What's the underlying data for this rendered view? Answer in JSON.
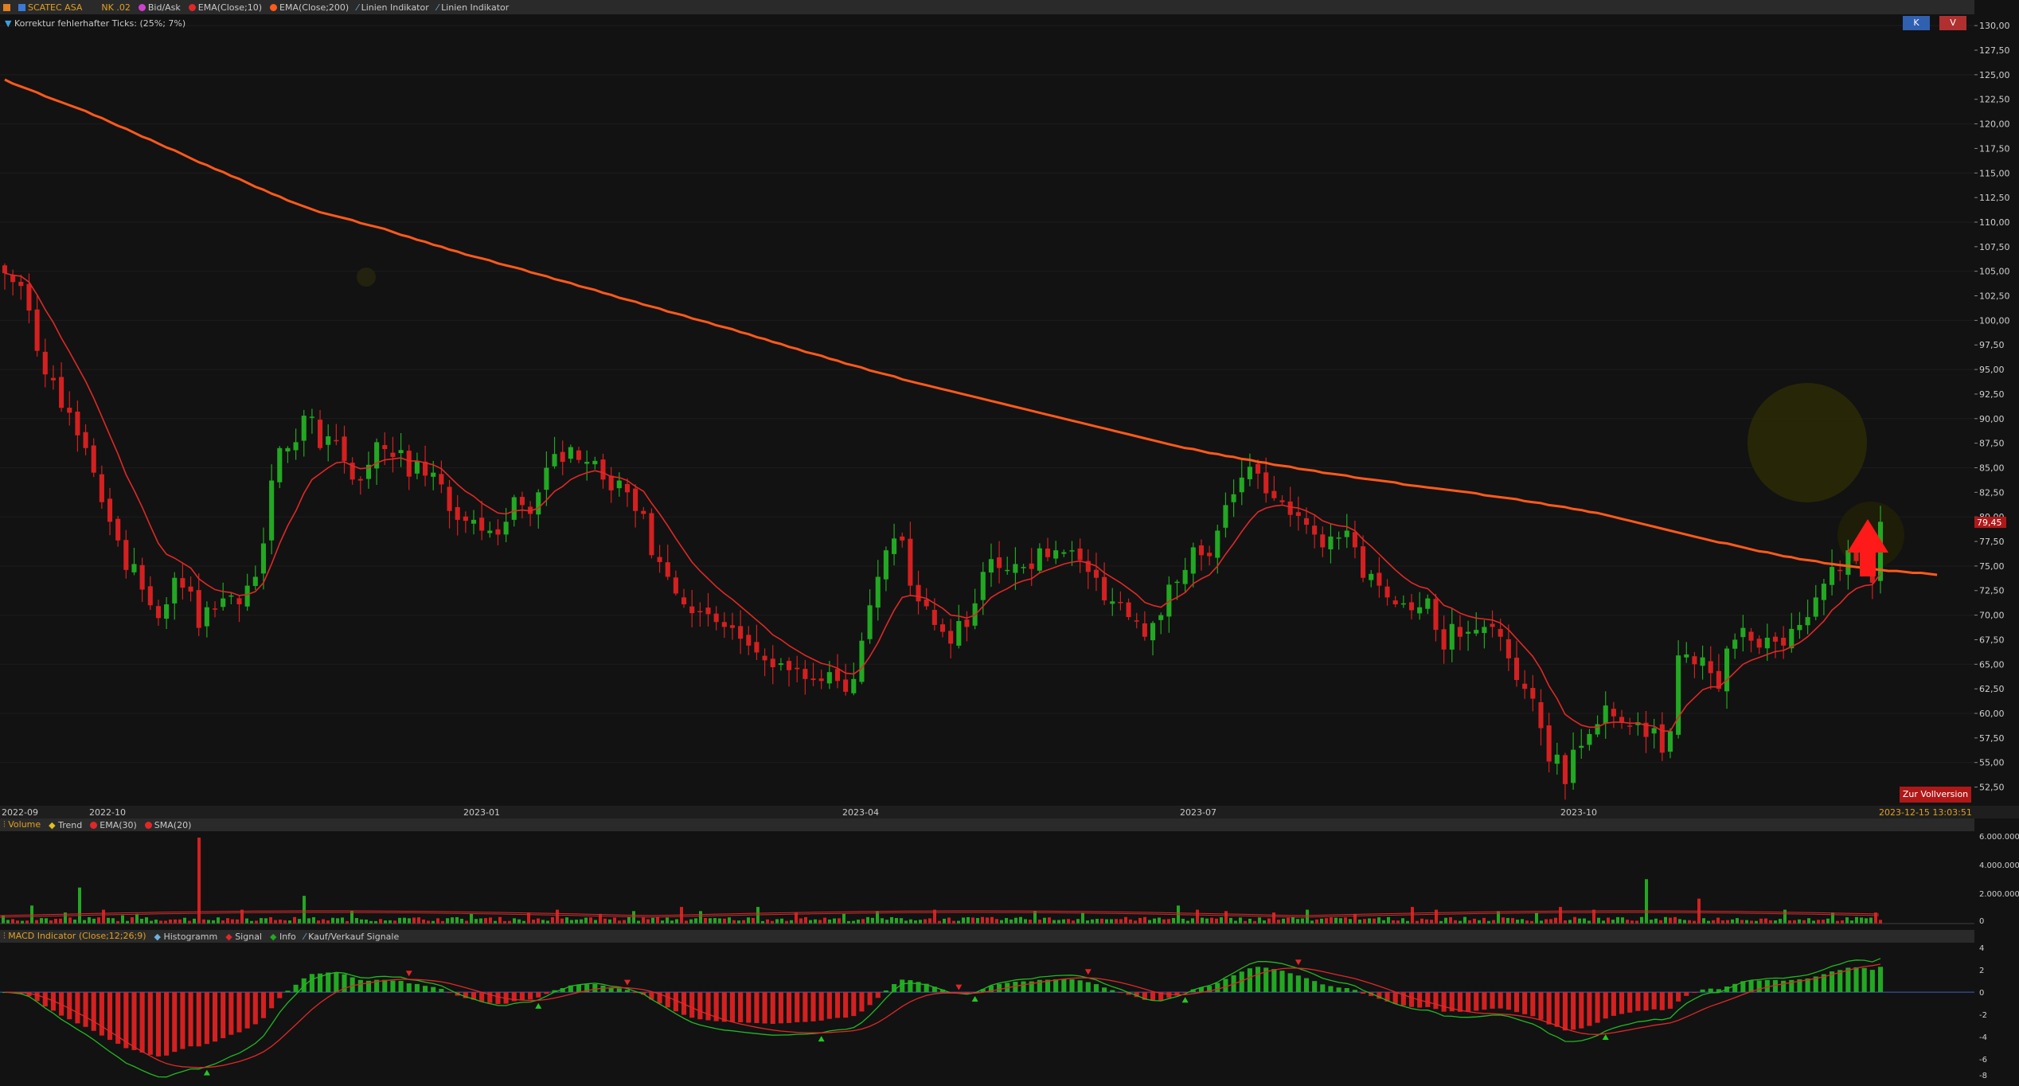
{
  "header": {
    "symbol": "SCATEC ASA",
    "nk": "NK .02",
    "indicators": [
      "Bid/Ask",
      "EMA(Close;10)",
      "EMA(Close;200)",
      "Linien Indikator",
      "Linien Indikator"
    ],
    "tick_correction": "Korrektur fehlerhafter Ticks: (25%; 7%)"
  },
  "buttons": {
    "k": "K",
    "v": "V",
    "full_version": "Zur Vollversion"
  },
  "price_axis": {
    "ticks": [
      "130,00",
      "127,50",
      "125,00",
      "122,50",
      "120,00",
      "117,50",
      "115,00",
      "112,50",
      "110,00",
      "107,50",
      "105,00",
      "102,50",
      "100,00",
      "97,50",
      "95,00",
      "92,50",
      "90,00",
      "87,50",
      "85,00",
      "82,50",
      "80,00",
      "77,50",
      "75,00",
      "72,50",
      "70,00",
      "67,50",
      "65,00",
      "62,50",
      "60,00",
      "57,50",
      "55,00",
      "52,50"
    ],
    "current_price": "79,45"
  },
  "time_axis": {
    "labels": [
      "2022-09",
      "2022-10",
      "2023-01",
      "2023-04",
      "2023-07",
      "2023-10"
    ],
    "timestamp": "2023-12-15 13:03:51"
  },
  "volume_panel": {
    "legend": [
      "Volume",
      "Trend",
      "EMA(30)",
      "SMA(20)"
    ],
    "axis": [
      "6.000.000",
      "4.000.000",
      "2.000.000",
      "0"
    ]
  },
  "macd_panel": {
    "legend": [
      "MACD Indicator (Close;12;26;9)",
      "Histogramm",
      "Signal",
      "Info",
      "Kauf/Verkauf Signale"
    ],
    "axis": [
      "4",
      "2",
      "0",
      "-2",
      "-4",
      "-6",
      "-8"
    ]
  },
  "colors": {
    "up": "#22a822",
    "down": "#d42020",
    "ema200": "#ff5a1a",
    "ema10": "#e02828",
    "arrow": "#ff1a1a",
    "badge": "#b01818"
  },
  "chart_data": {
    "type": "candlestick",
    "ylim": [
      50.6,
      130.5
    ],
    "closes": [
      104.8,
      103.9,
      103.5,
      101.0,
      96.9,
      94.5,
      93.9,
      91.1,
      90.6,
      88.3,
      87.0,
      84.5,
      81.5,
      79.5,
      77.6,
      74.6,
      75.2,
      72.6,
      71.0,
      69.7,
      71.1,
      73.8,
      72.8,
      72.4,
      68.7,
      70.8,
      70.6,
      71.7,
      72.0,
      71.1,
      73.0,
      73.9,
      77.3,
      83.7,
      87.0,
      87.0,
      87.6,
      90.3,
      90.2,
      87.0,
      88.2,
      87.8,
      85.7,
      83.8,
      83.7,
      85.3,
      87.6,
      86.9,
      86.1,
      86.8,
      84.1,
      85.7,
      84.2,
      84.5,
      83.3,
      80.6,
      79.7,
      79.6,
      79.7,
      78.6,
      78.6,
      78.2,
      79.5,
      82.0,
      81.2,
      80.3,
      82.5,
      85.0,
      86.4,
      85.6,
      87.1,
      85.8,
      85.6,
      85.7,
      83.8,
      82.7,
      83.7,
      82.5,
      80.6,
      80.3,
      76.1,
      75.4,
      73.9,
      72.2,
      71.1,
      70.2,
      70.4,
      70.1,
      69.3,
      68.8,
      68.7,
      67.6,
      66.9,
      66.2,
      65.4,
      64.7,
      65.1,
      64.4,
      64.5,
      63.5,
      63.4,
      63.3,
      64.2,
      63.3,
      62.2,
      63.5,
      67.4,
      71.0,
      73.9,
      76.6,
      77.8,
      77.6,
      73.0,
      71.4,
      70.9,
      69.0,
      68.3,
      67.1,
      69.4,
      68.8,
      71.2,
      74.4,
      75.7,
      74.8,
      74.6,
      75.2,
      74.9,
      74.7,
      76.8,
      75.9,
      76.6,
      76.4,
      76.6,
      75.6,
      74.4,
      73.8,
      71.5,
      71.4,
      71.3,
      69.8,
      69.4,
      67.8,
      69.2,
      70.0,
      73.1,
      73.4,
      74.6,
      76.9,
      76.1,
      76.0,
      78.6,
      81.2,
      82.3,
      84.0,
      85.1,
      84.4,
      82.4,
      81.9,
      81.5,
      80.2,
      80.1,
      79.2,
      78.2,
      76.9,
      78.0,
      77.9,
      78.6,
      76.9,
      73.8,
      74.2,
      73.0,
      71.8,
      71.1,
      71.2,
      70.5,
      70.8,
      71.7,
      68.5,
      66.5,
      69.1,
      67.8,
      68.3,
      68.5,
      68.8,
      68.8,
      67.8,
      65.6,
      63.4,
      62.5,
      61.5,
      58.5,
      55.1,
      55.8,
      52.8,
      56.3,
      56.7,
      57.9,
      58.9,
      60.8,
      59.7,
      59.1,
      58.7,
      59.1,
      57.6,
      58.5,
      56.0,
      58.2,
      65.9,
      66.0,
      65.0,
      65.7,
      64.1,
      62.5,
      66.6,
      67.5,
      68.7,
      67.4,
      66.7,
      67.7,
      67.3,
      66.9,
      68.6,
      69.0,
      69.8,
      71.8,
      73.2,
      74.9,
      74.5,
      76.6,
      75.5,
      74.7,
      73.3,
      79.5
    ],
    "ema200": [
      124.5,
      124.1,
      123.8,
      123.5,
      123.2,
      122.8,
      122.5,
      122.2,
      121.9,
      121.6,
      121.3,
      120.9,
      120.6,
      120.2,
      119.8,
      119.5,
      119.1,
      118.7,
      118.4,
      118.0,
      117.6,
      117.3,
      116.9,
      116.5,
      116.1,
      115.8,
      115.4,
      115.1,
      114.7,
      114.4,
      114.0,
      113.6,
      113.3,
      112.9,
      112.6,
      112.2,
      111.9,
      111.6,
      111.3,
      111.0,
      110.8,
      110.6,
      110.4,
      110.2,
      109.9,
      109.7,
      109.5,
      109.3,
      109.0,
      108.7,
      108.5,
      108.2,
      108.0,
      107.7,
      107.5,
      107.2,
      107.0,
      106.7,
      106.5,
      106.3,
      106.1,
      105.8,
      105.6,
      105.4,
      105.2,
      104.9,
      104.7,
      104.5,
      104.2,
      104.0,
      103.8,
      103.5,
      103.3,
      103.1,
      102.8,
      102.6,
      102.3,
      102.1,
      101.9,
      101.6,
      101.4,
      101.2,
      100.9,
      100.7,
      100.5,
      100.2,
      100.0,
      99.8,
      99.5,
      99.3,
      99.1,
      98.8,
      98.6,
      98.3,
      98.1,
      97.8,
      97.6,
      97.3,
      97.1,
      96.8,
      96.6,
      96.4,
      96.1,
      95.9,
      95.6,
      95.4,
      95.2,
      94.9,
      94.7,
      94.5,
      94.3,
      94.0,
      93.8,
      93.6,
      93.4,
      93.2,
      93.0,
      92.8,
      92.6,
      92.4,
      92.2,
      92.0,
      91.8,
      91.6,
      91.4,
      91.2,
      91.0,
      90.8,
      90.6,
      90.4,
      90.2,
      90.0,
      89.8,
      89.6,
      89.4,
      89.2,
      89.0,
      88.8,
      88.6,
      88.4,
      88.2,
      88.0,
      87.8,
      87.6,
      87.4,
      87.2,
      87.0,
      86.9,
      86.7,
      86.5,
      86.4,
      86.2,
      86.1,
      85.9,
      85.8,
      85.6,
      85.5,
      85.3,
      85.2,
      85.1,
      84.9,
      84.8,
      84.7,
      84.5,
      84.4,
      84.3,
      84.2,
      84.0,
      83.9,
      83.8,
      83.7,
      83.6,
      83.5,
      83.3,
      83.2,
      83.1,
      83.0,
      82.9,
      82.8,
      82.7,
      82.6,
      82.5,
      82.4,
      82.2,
      82.1,
      82.0,
      81.9,
      81.8,
      81.6,
      81.5,
      81.4,
      81.2,
      81.1,
      81.0,
      80.8,
      80.7,
      80.5,
      80.4,
      80.2,
      80.0,
      79.8,
      79.6,
      79.4,
      79.2,
      79.0,
      78.8,
      78.6,
      78.4,
      78.2,
      78.0,
      77.8,
      77.6,
      77.4,
      77.3,
      77.1,
      76.9,
      76.7,
      76.5,
      76.4,
      76.2,
      76.0,
      75.9,
      75.7,
      75.6,
      75.5,
      75.3,
      75.2,
      75.1,
      75.0,
      74.9,
      74.8,
      74.7,
      74.6,
      74.5,
      74.5,
      74.4,
      74.3,
      74.3,
      74.2,
      74.1
    ],
    "ema10": [
      104.8,
      104.6,
      104.5,
      103.9,
      102.6,
      101.1,
      99.8,
      98.2,
      96.8,
      95.3,
      93.8,
      92.1,
      90.2,
      88.3,
      86.4,
      84.3,
      82.7,
      81.0,
      79.1,
      77.3,
      76.2,
      75.8,
      75.3,
      74.8,
      73.7,
      73.1,
      72.6,
      72.4,
      72.3,
      72.0,
      72.1,
      72.4,
      73.3,
      75.2,
      77.3,
      79.1,
      80.6,
      82.4,
      83.8,
      84.4,
      85.0,
      85.5,
      85.6,
      85.2,
      84.9,
      85.0,
      85.5,
      85.8,
      85.9,
      86.0,
      85.7,
      85.7,
      85.5,
      85.3,
      84.9,
      84.1,
      83.3,
      82.6,
      82.1,
      81.4,
      80.9,
      80.4,
      80.3,
      80.6,
      80.7,
      80.6,
      80.9,
      81.7,
      82.6,
      83.1,
      83.8,
      84.2,
      84.5,
      84.7,
      84.5,
      84.1,
      84.0,
      83.7,
      83.1,
      82.6,
      81.4,
      80.3,
      79.1,
      77.8,
      76.6,
      75.4,
      74.5,
      73.7,
      72.9,
      72.2,
      71.6,
      70.9,
      70.2,
      69.5,
      68.8,
      68.0,
      67.5,
      66.9,
      66.4,
      65.9,
      65.5,
      65.1,
      64.9,
      64.6,
      64.1,
      64.0,
      64.6,
      65.8,
      67.2,
      68.9,
      70.5,
      71.8,
      72.0,
      71.9,
      71.7,
      71.2,
      70.7,
      70.0,
      69.9,
      69.7,
      70.0,
      70.9,
      71.8,
      72.3,
      72.7,
      73.2,
      73.5,
      73.7,
      74.3,
      74.6,
      74.9,
      75.2,
      75.4,
      75.5,
      75.3,
      75.0,
      74.3,
      73.8,
      73.3,
      72.7,
      72.1,
      71.3,
      71.0,
      70.8,
      71.4,
      71.8,
      72.3,
      73.2,
      73.7,
      74.1,
      75.0,
      76.2,
      77.3,
      78.5,
      79.6,
      80.5,
      80.9,
      81.1,
      81.2,
      81.0,
      80.9,
      80.6,
      80.2,
      79.6,
      79.3,
      79.1,
      79.0,
      78.6,
      77.7,
      77.0,
      76.2,
      75.4,
      74.6,
      73.9,
      73.3,
      72.9,
      72.7,
      71.9,
      71.0,
      70.7,
      70.2,
      69.9,
      69.7,
      69.6,
      69.5,
      69.2,
      68.5,
      67.6,
      66.7,
      65.8,
      64.5,
      62.8,
      61.5,
      59.9,
      59.3,
      58.8,
      58.6,
      58.6,
      59.0,
      59.1,
      59.1,
      59.0,
      59.0,
      58.8,
      58.7,
      58.2,
      58.2,
      59.6,
      60.8,
      61.6,
      62.4,
      62.7,
      62.7,
      63.4,
      64.2,
      65.0,
      65.4,
      65.7,
      66.0,
      66.3,
      66.4,
      66.8,
      67.2,
      67.8,
      68.6,
      69.4,
      70.5,
      71.2,
      72.1,
      72.7,
      73.0,
      73.1,
      74.2
    ],
    "volume_peak": 6200000,
    "macd_ylim": [
      -8.8,
      4.8
    ]
  }
}
